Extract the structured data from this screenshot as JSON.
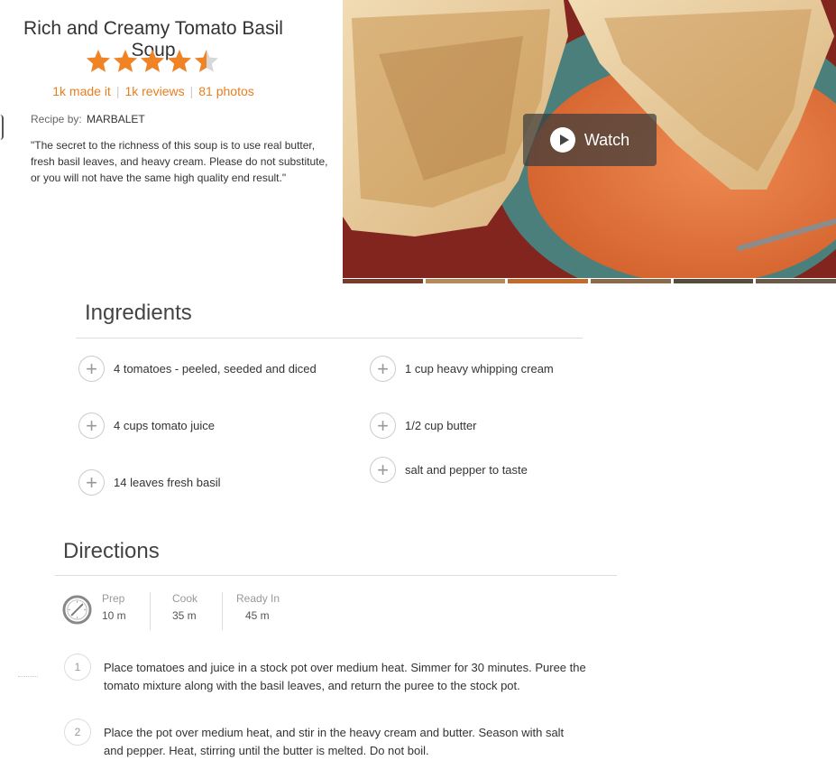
{
  "recipe": {
    "title": "Rich and Creamy Tomato Basil Soup",
    "rating": 4.5,
    "made_it": "1k made it",
    "reviews": "1k reviews",
    "photos": "81 photos",
    "byline_label": "Recipe by:",
    "author": "MARBALET",
    "description": "\"The secret to the richness of this soup is to use real butter, fresh basil leaves, and heavy cream. Please do not substitute, or you will not have the same high quality end result.\""
  },
  "media": {
    "watch_label": "Watch"
  },
  "ingredients": {
    "heading": "Ingredients",
    "items": [
      "4 tomatoes - peeled, seeded and diced",
      "4 cups tomato juice",
      "14 leaves fresh basil",
      "1 cup heavy whipping cream",
      "1/2 cup butter",
      "salt and pepper to taste"
    ]
  },
  "directions": {
    "heading": "Directions",
    "times": [
      {
        "label": "Prep",
        "value": "10 m"
      },
      {
        "label": "Cook",
        "value": "35 m"
      },
      {
        "label": "Ready In",
        "value": "45 m"
      }
    ],
    "steps": [
      {
        "number": "1",
        "text": "Place tomatoes and juice in a stock pot over medium heat. Simmer for 30 minutes. Puree the tomato mixture along with the basil leaves, and return the puree to the stock pot."
      },
      {
        "number": "2",
        "text": "Place the pot over medium heat, and stir in the heavy cream and butter. Season with salt and pepper. Heat, stirring until the butter is melted. Do not boil."
      }
    ]
  },
  "colors": {
    "accent": "#e67e22",
    "star": "#f08324",
    "star_empty": "#d8d8d8"
  },
  "icons": [
    "star-icon",
    "play-icon",
    "plus-icon",
    "clock-icon"
  ]
}
